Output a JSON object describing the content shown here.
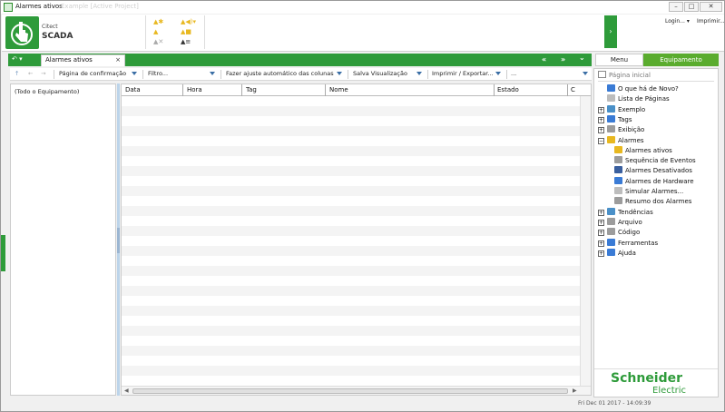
{
  "window": {
    "title": "Alarmes ativos",
    "subtitle": "Example [Active Project]"
  },
  "header": {
    "brand_line1": "Citect",
    "brand_line2": "SCADA",
    "login_label": "Login... ▾",
    "print_label": "Imprimir..."
  },
  "tabbar": {
    "active_tab": "Alarmes ativos",
    "close": "×",
    "nav_prev": "«",
    "nav_next": "»",
    "nav_menu": "⌄"
  },
  "right_tabs": {
    "menu": "Menu",
    "equipment": "Equipamento"
  },
  "toolbar": {
    "confirm_page": "Página de confirmação",
    "filter": "Filtro...",
    "autofit": "Fazer ajuste automático das colunas",
    "save_view": "Salva Visualização",
    "print_export": "Imprimir / Exportar...",
    "more": "..."
  },
  "left_tree": {
    "root": "(Todo o Equipamento)"
  },
  "table": {
    "columns": [
      "Data",
      "Hora",
      "Tag",
      "Nome",
      "Estado",
      "C"
    ]
  },
  "nav": {
    "home": "Página inicial",
    "items": [
      {
        "label": "O que há de Novo?",
        "level": 1,
        "expander": "",
        "color": "#3a7bd5"
      },
      {
        "label": "Lista de Páginas",
        "level": 1,
        "expander": "",
        "color": "#bdbdbd"
      },
      {
        "label": "Exemplo",
        "level": 0,
        "expander": "+",
        "color": "#4a90c8"
      },
      {
        "label": "Tags",
        "level": 0,
        "expander": "+",
        "color": "#3a7bd5"
      },
      {
        "label": "Exibição",
        "level": 0,
        "expander": "+",
        "color": "#9c9c9c"
      },
      {
        "label": "Alarmes",
        "level": 0,
        "expander": "−",
        "color": "#e8b820"
      },
      {
        "label": "Alarmes ativos",
        "level": 2,
        "expander": "",
        "color": "#e8b820"
      },
      {
        "label": "Sequência de Eventos",
        "level": 2,
        "expander": "",
        "color": "#9c9c9c"
      },
      {
        "label": "Alarmes Desativados",
        "level": 2,
        "expander": "",
        "color": "#3a5f9e"
      },
      {
        "label": "Alarmes de Hardware",
        "level": 2,
        "expander": "",
        "color": "#3a7bd5"
      },
      {
        "label": "Simular Alarmes...",
        "level": 2,
        "expander": "",
        "color": "#bdbdbd"
      },
      {
        "label": "Resumo dos Alarmes",
        "level": 2,
        "expander": "",
        "color": "#9c9c9c"
      },
      {
        "label": "Tendências",
        "level": 0,
        "expander": "+",
        "color": "#4a90c8"
      },
      {
        "label": "Arquivo",
        "level": 0,
        "expander": "+",
        "color": "#9c9c9c"
      },
      {
        "label": "Código",
        "level": 0,
        "expander": "+",
        "color": "#9c9c9c"
      },
      {
        "label": "Ferramentas",
        "level": 0,
        "expander": "+",
        "color": "#3a7bd5"
      },
      {
        "label": "Ajuda",
        "level": 0,
        "expander": "+",
        "color": "#3a7bd5"
      }
    ]
  },
  "logo": {
    "line1": "Schneider",
    "line2": "Electric"
  },
  "status": {
    "datetime": "Fri Dec 01 2017 - 14:09:39"
  },
  "colors": {
    "brand_green": "#2e9b3a",
    "equipment_tab": "#5aac2e"
  }
}
